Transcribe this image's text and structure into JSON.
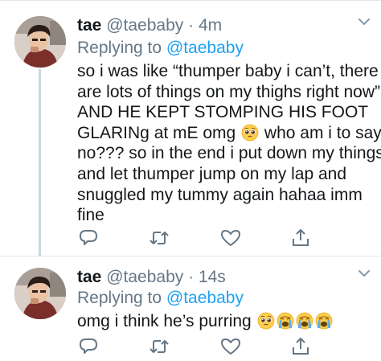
{
  "tweets": [
    {
      "name": "tae",
      "handle": "@taebaby",
      "separator": "·",
      "time": "4m",
      "replying_prefix": "Replying to",
      "replying_to": "@taebaby",
      "lines": [
        "so i was like “thumper baby i can’t, there",
        "are lots of things on my thighs right now”",
        "AND HE KEPT STOMPING HIS FOOT",
        "GLARINg at mE omg",
        " who am i to say",
        "no??? so in the end i put down my things",
        "and let thumper jump on my lap and",
        "snuggled my tummy again hahaa imm",
        "fine"
      ],
      "inline_emoji": [
        "pleading-face-emoji"
      ]
    },
    {
      "name": "tae",
      "handle": "@taebaby",
      "separator": "·",
      "time": "14s",
      "replying_prefix": "Replying to",
      "replying_to": "@taebaby",
      "text": "omg i think he’s purring",
      "emojis": [
        "pleading-face-emoji",
        "loudly-crying-face-emoji",
        "loudly-crying-face-emoji",
        "loudly-crying-face-emoji"
      ]
    }
  ],
  "icons": {
    "more": "chevron-down-icon",
    "reply": "reply-icon",
    "retweet": "retweet-icon",
    "like": "heart-icon",
    "share": "share-icon"
  },
  "colors": {
    "text": "#14171a",
    "secondary": "#657786",
    "link": "#1da1f2",
    "divider": "#e1e8ed",
    "thread_line": "#ccd6dd"
  }
}
